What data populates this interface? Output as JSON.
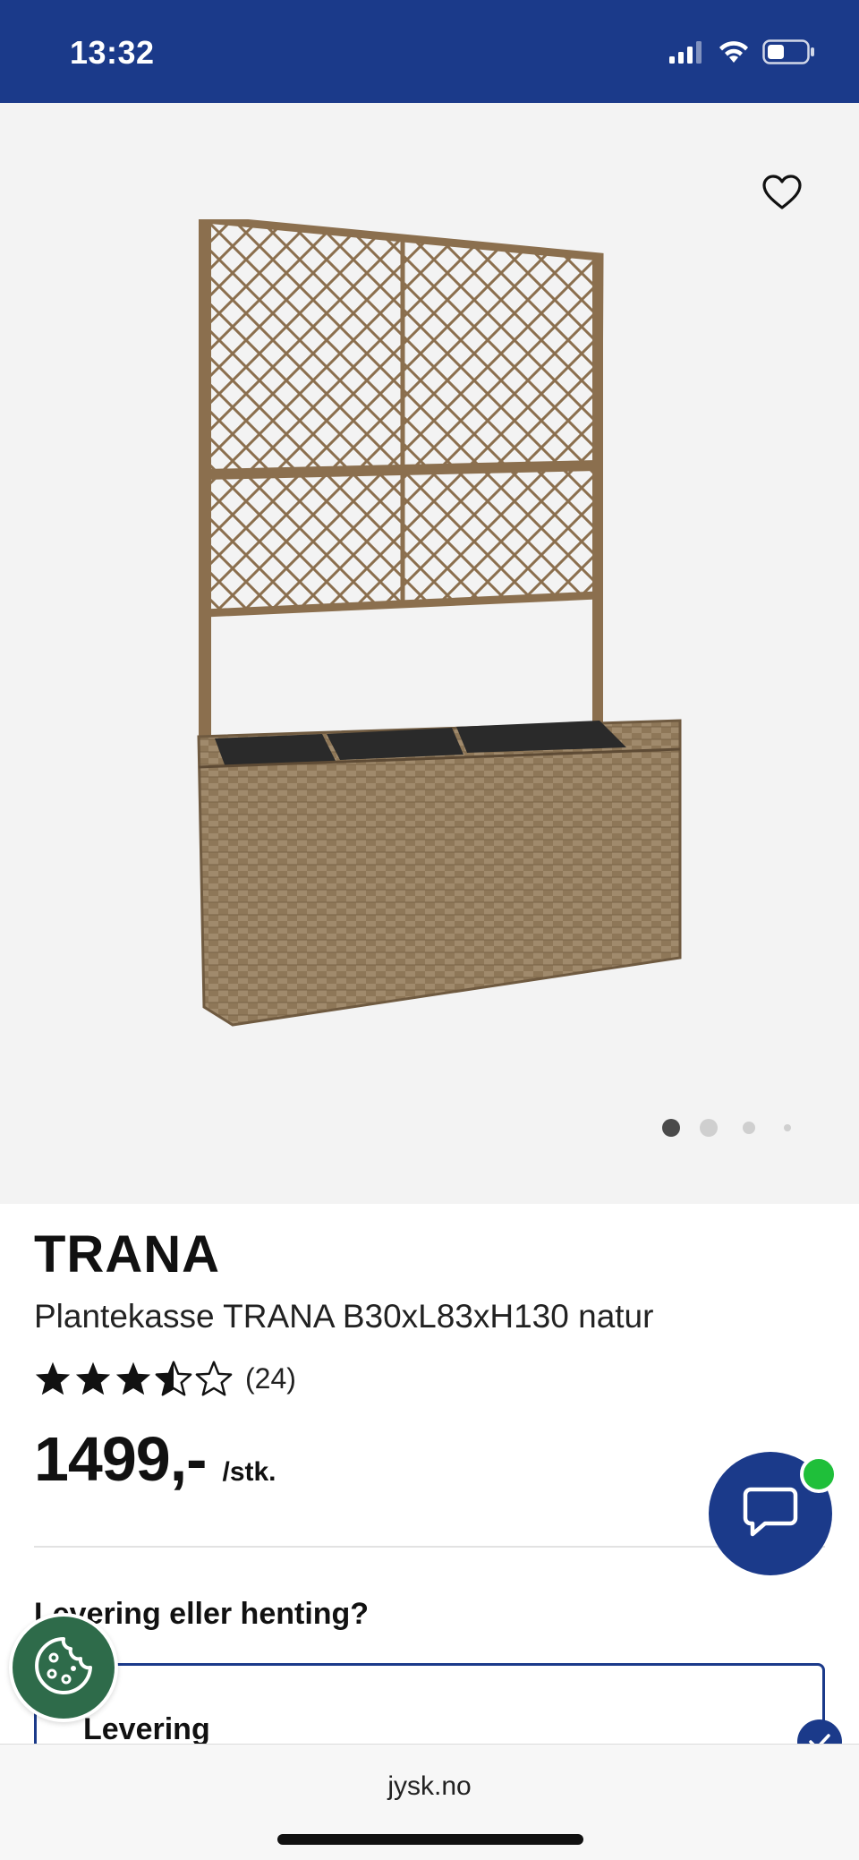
{
  "status_bar": {
    "time": "13:32",
    "icons": [
      "cellular-signal-icon",
      "wifi-icon",
      "battery-icon"
    ],
    "background": "#1b3a8a"
  },
  "gallery": {
    "favorite_icon": "heart-outline-icon",
    "page_count": 4,
    "active_page": 1
  },
  "product": {
    "brand": "TRANA",
    "subtitle": "Plantekasse TRANA B30xL83xH130 natur",
    "rating": 3.5,
    "rating_max": 5,
    "review_count": "(24)",
    "price": "1499,-",
    "price_unit": "/stk."
  },
  "delivery": {
    "heading": "Levering eller henting?",
    "option_label": "Levering",
    "selected": true
  },
  "chat": {
    "icon": "chat-bubble-icon",
    "online_color": "#1fbf3a"
  },
  "cookie": {
    "icon": "cookie-icon"
  },
  "browser": {
    "url": "jysk.no"
  },
  "colors": {
    "brand_blue": "#1b3a8a",
    "cookie_green": "#2e6b4a"
  }
}
